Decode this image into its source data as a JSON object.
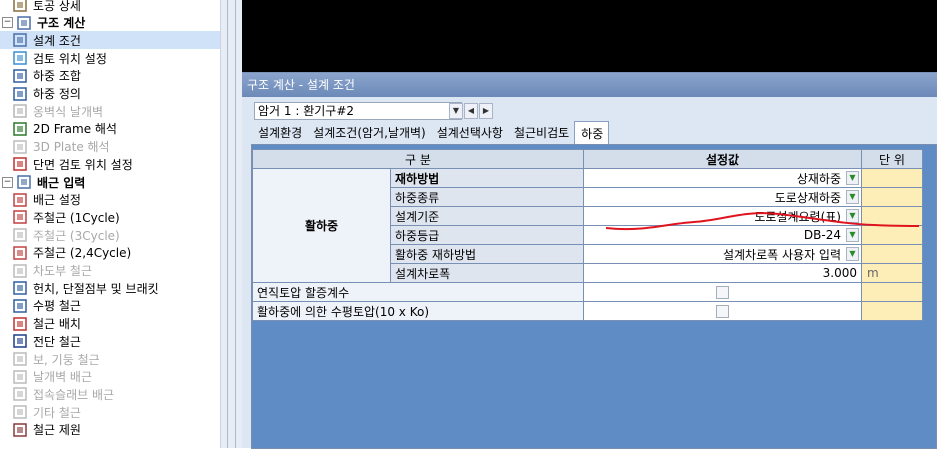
{
  "tree": [
    {
      "label": "토공 상세",
      "icon": "earthwork-icon",
      "level": 1,
      "disabled": false
    },
    {
      "label": "구조 계산",
      "icon": "calculation-icon",
      "level": 0,
      "expander": "⊟"
    },
    {
      "label": "설계 조건",
      "icon": "design-condition-icon",
      "level": 1,
      "selected": true
    },
    {
      "label": "검토 위치 설정",
      "icon": "review-location-icon",
      "level": 1
    },
    {
      "label": "하중 조합",
      "icon": "load-combination-icon",
      "level": 1
    },
    {
      "label": "하중 정의",
      "icon": "load-definition-icon",
      "level": 1
    },
    {
      "label": "옹벽식 날개벽",
      "icon": "retaining-wing-wall-icon",
      "level": 1,
      "disabled": true
    },
    {
      "label": "2D Frame 해석",
      "icon": "frame-2d-icon",
      "level": 1
    },
    {
      "label": "3D Plate 해석",
      "icon": "plate-3d-icon",
      "level": 1,
      "disabled": true
    },
    {
      "label": "단면 검토 위치 설정",
      "icon": "section-review-icon",
      "level": 1
    },
    {
      "label": "배근 입력",
      "icon": "rebar-input-icon",
      "level": 0,
      "expander": "⊟"
    },
    {
      "label": "배근 설정",
      "icon": "rebar-setting-icon",
      "level": 1
    },
    {
      "label": "주철근 (1Cycle)",
      "icon": "main-rebar-1cycle-icon",
      "level": 1
    },
    {
      "label": "주철근 (3Cycle)",
      "icon": "main-rebar-3cycle-icon",
      "level": 1,
      "disabled": true
    },
    {
      "label": "주철근 (2,4Cycle)",
      "icon": "main-rebar-24cycle-icon",
      "level": 1
    },
    {
      "label": "차도부 철근",
      "icon": "roadway-rebar-icon",
      "level": 1,
      "disabled": true
    },
    {
      "label": "헌치, 단절점부 및 브래킷",
      "icon": "haunch-bracket-icon",
      "level": 1
    },
    {
      "label": "수평 철근",
      "icon": "horizontal-rebar-icon",
      "level": 1
    },
    {
      "label": "철근 배치",
      "icon": "rebar-layout-icon",
      "level": 1
    },
    {
      "label": "전단 철근",
      "icon": "shear-rebar-icon",
      "level": 1
    },
    {
      "label": "보, 기둥 철근",
      "icon": "beam-column-rebar-icon",
      "level": 1,
      "disabled": true
    },
    {
      "label": "날개벽 배근",
      "icon": "wing-wall-rebar-icon",
      "level": 1,
      "disabled": true
    },
    {
      "label": "접속슬래브 배근",
      "icon": "approach-slab-rebar-icon",
      "level": 1,
      "disabled": true
    },
    {
      "label": "기타 철근",
      "icon": "other-rebar-icon",
      "level": 1,
      "disabled": true
    },
    {
      "label": "철근 제원",
      "icon": "rebar-spec-icon",
      "level": 1
    }
  ],
  "panel": {
    "title": "구조 계산 - 설계 조건",
    "combo_value": "암거 1 : 환기구#2",
    "combo_arrow": "▼",
    "nav_prev": "◀",
    "nav_next": "▶",
    "tabs": [
      "설계환경",
      "설계조건(암거,날개벽)",
      "설계선택사항",
      "철근비검토",
      "하중"
    ],
    "active_tab": 4
  },
  "grid": {
    "headers": {
      "category": "구 분",
      "value": "설정값",
      "unit": "단 위"
    },
    "group_label": "활하중",
    "rows": [
      {
        "label": "재하방법",
        "value": "상재하중",
        "dropdown": true,
        "bold": true
      },
      {
        "label": "하중종류",
        "value": "도로상재하중",
        "dropdown": true
      },
      {
        "label": "설계기준",
        "value": "도로설계요령(표)",
        "dropdown": true
      },
      {
        "label": "하중등급",
        "value": "DB-24",
        "dropdown": true
      },
      {
        "label": "활하중 재하방법",
        "value": "설계차로폭 사용자 입력",
        "dropdown": true
      },
      {
        "label": "설계차로폭",
        "value": "3.000",
        "unit": "m"
      }
    ],
    "checkbox_rows": [
      {
        "label": "연직토압 할증계수",
        "checked": false
      },
      {
        "label": "활하중에 의한 수평토압(10 x Ko)",
        "checked": false
      }
    ],
    "dropdown_glyph": "▼"
  },
  "colors": {
    "tree_selected": "#cfe2f7",
    "panel_title": "#6c89b8",
    "grid_background": "#5f8cc5",
    "unit_cell": "#fdeeb8",
    "annotation": "#e0141e"
  }
}
